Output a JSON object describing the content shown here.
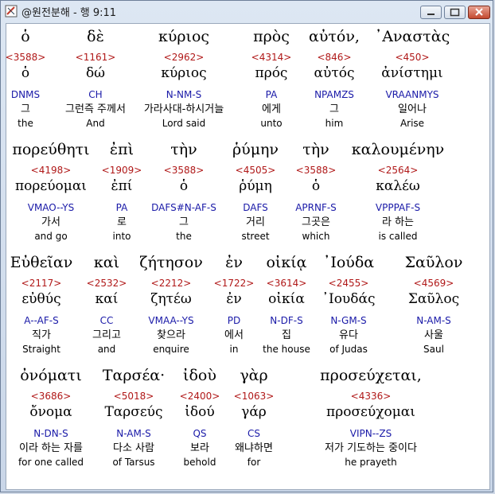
{
  "window": {
    "title": "@원전분해 - 행 9:11",
    "buttons": [
      "minimize",
      "maximize",
      "close"
    ]
  },
  "lines": [
    {
      "words": [
        {
          "greek": "ὁ",
          "strong": "<3588>",
          "lemma": "ὁ",
          "morph": "DNMS",
          "korean": "그",
          "english": "the",
          "highlight": true
        },
        {
          "greek": "δὲ",
          "strong": "<1161>",
          "lemma": "δώ",
          "morph": "CH",
          "korean": "그런즉 주께서",
          "english": "And"
        },
        {
          "greek": "κύριος",
          "strong": "<2962>",
          "lemma": "κύριος",
          "morph": "N-NM-S",
          "korean": "가라사대-하시거늘",
          "english": "Lord said"
        },
        {
          "greek": "πρὸς",
          "strong": "<4314>",
          "lemma": "πρός",
          "morph": "PA",
          "korean": "에게",
          "english": "unto"
        },
        {
          "greek": "αὐτόν,",
          "strong": "<846>",
          "lemma": "αὐτός",
          "morph": "NPAMZS",
          "korean": "그",
          "english": "him"
        },
        {
          "greek": "᾽Αναστὰς",
          "strong": "<450>",
          "lemma": "ἀνίστημι",
          "morph": "VRAANMYS",
          "korean": "일어나",
          "english": "Arise"
        }
      ]
    },
    {
      "words": [
        {
          "greek": "πορεύθητι",
          "strong": "<4198>",
          "lemma": "πορεύομαι",
          "morph": "VMAO--YS",
          "korean": "가서",
          "english": "and go"
        },
        {
          "greek": "ἐπὶ",
          "strong": "<1909>",
          "lemma": "ἐπί",
          "morph": "PA",
          "korean": "로",
          "english": "into"
        },
        {
          "greek": "τὴν",
          "strong": "<3588>",
          "lemma": "ὁ",
          "morph": "DAFS#N-AF-S",
          "korean": "그",
          "english": "the"
        },
        {
          "greek": "ῥύμην",
          "strong": "<4505>",
          "lemma": "ῥύμη",
          "morph": "DAFS",
          "korean": "거리",
          "english": "street"
        },
        {
          "greek": "τὴν",
          "strong": "<3588>",
          "lemma": "ὁ",
          "morph": "APRNF-S",
          "korean": "그곳은",
          "english": "which"
        },
        {
          "greek": "καλουμένην",
          "strong": "<2564>",
          "lemma": "καλέω",
          "morph": "VPPPAF-S",
          "korean": "라 하는",
          "english": "is called"
        }
      ]
    },
    {
      "words": [
        {
          "greek": "Εὐθεῖαν",
          "strong": "<2117>",
          "lemma": "εὐθύς",
          "morph": "A--AF-S",
          "korean": "직가",
          "english": "Straight"
        },
        {
          "greek": "καὶ",
          "strong": "<2532>",
          "lemma": "καί",
          "morph": "CC",
          "korean": "그리고",
          "english": "and"
        },
        {
          "greek": "ζήτησον",
          "strong": "<2212>",
          "lemma": "ζητέω",
          "morph": "VMAA--YS",
          "korean": "찾으라",
          "english": "enquire"
        },
        {
          "greek": "ἐν",
          "strong": "<1722>",
          "lemma": "ἐν",
          "morph": "PD",
          "korean": "에서",
          "english": "in"
        },
        {
          "greek": "οἰκίᾳ",
          "strong": "<3614>",
          "lemma": "οἰκία",
          "morph": "N-DF-S",
          "korean": "집",
          "english": "the house"
        },
        {
          "greek": "᾽Ιούδα",
          "strong": "<2455>",
          "lemma": "᾽Ιουδάς",
          "morph": "N-GM-S",
          "korean": "유다",
          "english": "of Judas"
        },
        {
          "greek": "Σαῦλον",
          "strong": "<4569>",
          "lemma": "Σαῦλος",
          "morph": "N-AM-S",
          "korean": "사울",
          "english": "Saul"
        }
      ]
    },
    {
      "words": [
        {
          "greek": "ὀνόματι",
          "strong": "<3686>",
          "lemma": "ὄνομα",
          "morph": "N-DN-S",
          "korean": "이라 하는 자를",
          "english": "for one called"
        },
        {
          "greek": "Ταρσέα·",
          "strong": "<5018>",
          "lemma": "Ταρσεύς",
          "morph": "N-AM-S",
          "korean": "다소 사람",
          "english": "of Tarsus"
        },
        {
          "greek": "ἰδοὺ",
          "strong": "<2400>",
          "lemma": "ἰδού",
          "morph": "QS",
          "korean": "보라",
          "english": "behold"
        },
        {
          "greek": "γὰρ",
          "strong": "<1063>",
          "lemma": "γάρ",
          "morph": "CS",
          "korean": "왜냐하면",
          "english": "for"
        },
        {
          "greek": "προσεύχεται,",
          "strong": "<4336>",
          "lemma": "προσεύχομαι",
          "morph": "VIPN--ZS",
          "korean": "저가 기도하는 중이다",
          "english": "he prayeth"
        }
      ]
    }
  ]
}
